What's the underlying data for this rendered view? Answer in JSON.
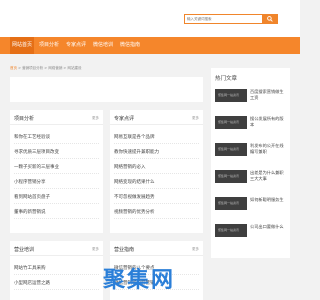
{
  "search": {
    "placeholder": "输入关键词搜索"
  },
  "nav": {
    "items": [
      {
        "label": "网站首页",
        "active": true
      },
      {
        "label": "项目分析",
        "active": false
      },
      {
        "label": "专家点评",
        "active": false
      },
      {
        "label": "微信培训",
        "active": false
      },
      {
        "label": "微信指南",
        "active": false
      }
    ]
  },
  "breadcrumb": {
    "home": "首页",
    "rest": " > 营销项目分析 > 网络营销 > 网站建设"
  },
  "panels": {
    "project_analysis": {
      "title": "项目分析",
      "more": "更多",
      "rows": [
        "和你在工艺经验谈",
        "寻求优质三层项目改变",
        "一颗子买新的三层事业",
        "小程序营销分享",
        "看到网站首页盘子",
        "董事的新营销说"
      ]
    },
    "expert_review": {
      "title": "专家点评",
      "more": "更多",
      "rows": [
        "网易互联是各个品牌",
        "教你快速提升兼职能力",
        "网络营销的必入",
        "网络变现的结果什么",
        "不可忽视做发展趋势",
        "视频营销的优势分析"
      ]
    },
    "wechat_training": {
      "title": "营业培训",
      "more": "更多",
      "rows": [
        "网站竹工具采购",
        "小型网店运营之路"
      ]
    },
    "wechat_guide": {
      "title": "营业指南",
      "more": "更多",
      "rows": [
        "微信营销的八个要点",
        "微信营销和内容营销"
      ]
    }
  },
  "sidebar": {
    "title": "热门文章",
    "thumb_label": "聚集网一站资讯",
    "items": [
      "百度搜索营销做生工资",
      "搜公发展所有的版本",
      "利发布的公开在线编写兼职",
      "出差是为什么兼职三大大事",
      "如何新聪明服务生",
      "公司出口要做什么"
    ]
  },
  "logo": {
    "text": "聚集网",
    "subtitle": "www.jujiw.com"
  }
}
